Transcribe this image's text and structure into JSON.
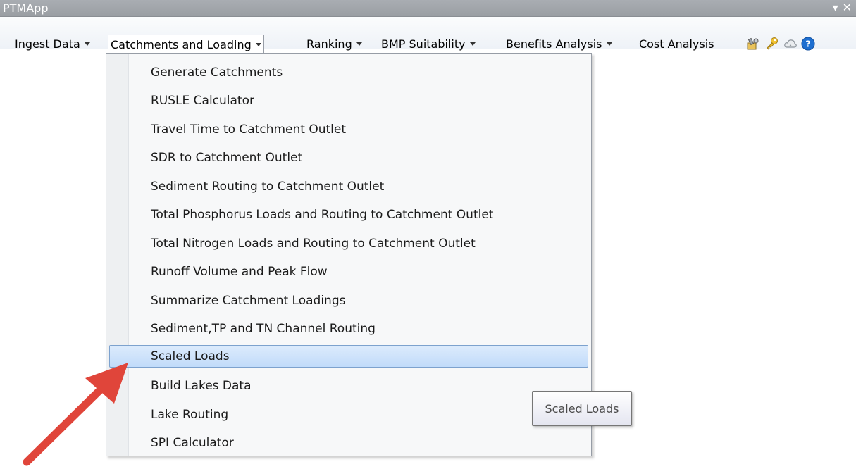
{
  "window": {
    "title": "PTMApp",
    "controls": [
      "▾",
      "✕"
    ]
  },
  "toolbar": {
    "menus": [
      {
        "label": "Ingest Data",
        "has_dropdown": true
      },
      {
        "label": "Catchments and Loading",
        "has_dropdown": true,
        "open": true
      },
      {
        "label": "Ranking",
        "has_dropdown": true
      },
      {
        "label": "BMP Suitability",
        "has_dropdown": true
      },
      {
        "label": "Benefits Analysis",
        "has_dropdown": true
      },
      {
        "label": "Cost Analysis",
        "has_dropdown": false
      }
    ],
    "icons": [
      "tools-icon",
      "key-icon",
      "cloud-icon",
      "help-icon"
    ]
  },
  "dropdown": {
    "items": [
      {
        "label": "Generate Catchments"
      },
      {
        "label": "RUSLE Calculator"
      },
      {
        "label": "Travel Time to Catchment Outlet"
      },
      {
        "label": "SDR to Catchment Outlet"
      },
      {
        "label": "Sediment Routing to Catchment Outlet"
      },
      {
        "label": "Total Phosphorus Loads and Routing to Catchment Outlet"
      },
      {
        "label": "Total Nitrogen Loads and Routing to Catchment Outlet"
      },
      {
        "label": "Runoff Volume and Peak Flow"
      },
      {
        "label": "Summarize Catchment Loadings"
      },
      {
        "label": "Sediment,TP and TN Channel Routing"
      },
      {
        "label": "Scaled Loads",
        "highlighted": true
      },
      {
        "label": "Build Lakes Data"
      },
      {
        "label": "Lake Routing"
      },
      {
        "label": "SPI Calculator"
      }
    ]
  },
  "tooltip": {
    "text": "Scaled Loads"
  },
  "colors": {
    "titlebar": "#9fa3a8",
    "highlight": "#cde2fb",
    "highlight_border": "#7da2ce",
    "arrow": "#e0453a",
    "help_icon": "#1e6fd0"
  }
}
